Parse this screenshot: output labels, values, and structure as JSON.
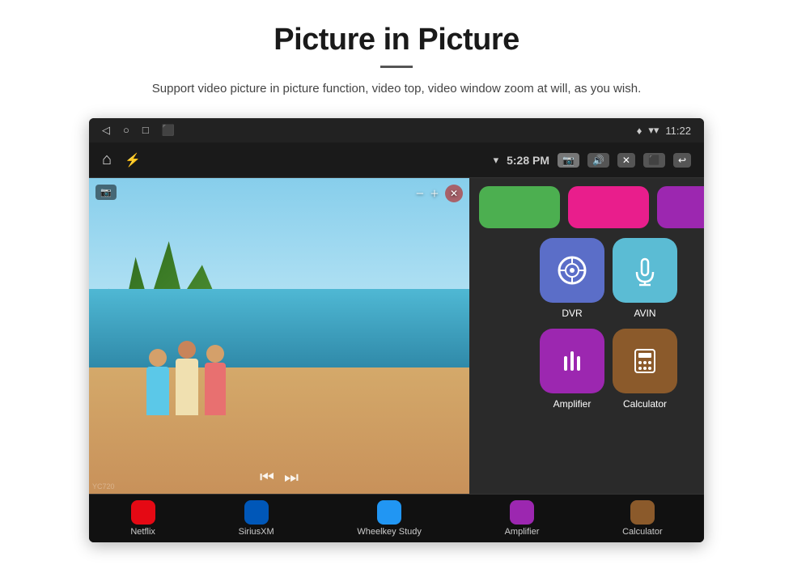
{
  "header": {
    "title": "Picture in Picture",
    "subtitle": "Support video picture in picture function, video top, video window zoom at will, as you wish."
  },
  "statusBar": {
    "time": "11:22",
    "navIcons": [
      "◁",
      "○",
      "□",
      "⬛"
    ],
    "rightIcons": [
      "location",
      "wifi",
      "time"
    ]
  },
  "navBar": {
    "time": "5:28 PM",
    "buttons": [
      "📷",
      "🔊",
      "✕",
      "⬛",
      "↩"
    ]
  },
  "pipVideo": {
    "topLabel": "📷",
    "controls": [
      "−",
      "+",
      "✕"
    ],
    "playbackButtons": [
      "⏮",
      "⏭"
    ]
  },
  "apps": {
    "topRow": [
      {
        "id": "dvr",
        "label": "DVR",
        "icon": "📡",
        "color": "#5b6ec8"
      },
      {
        "id": "avin",
        "label": "AVIN",
        "icon": "🔌",
        "color": "#5bbcd4"
      }
    ],
    "bottomRow": [
      {
        "id": "amplifier",
        "label": "Amplifier",
        "icon": "🎛",
        "color": "#9c27b0"
      },
      {
        "id": "calculator",
        "label": "Calculator",
        "icon": "🧮",
        "color": "#8B5A2B"
      }
    ]
  },
  "bottomApps": [
    {
      "id": "netflix",
      "label": "Netflix",
      "color": "#e50914"
    },
    {
      "id": "siriusxm",
      "label": "SiriusXM",
      "color": "#0057b8"
    },
    {
      "id": "wheelkey",
      "label": "Wheelkey Study",
      "color": "#2196F3"
    },
    {
      "id": "amplifier",
      "label": "Amplifier",
      "color": "#9c27b0"
    },
    {
      "id": "calculator",
      "label": "Calculator",
      "color": "#8B5A2B"
    }
  ],
  "watermark": "YC720"
}
